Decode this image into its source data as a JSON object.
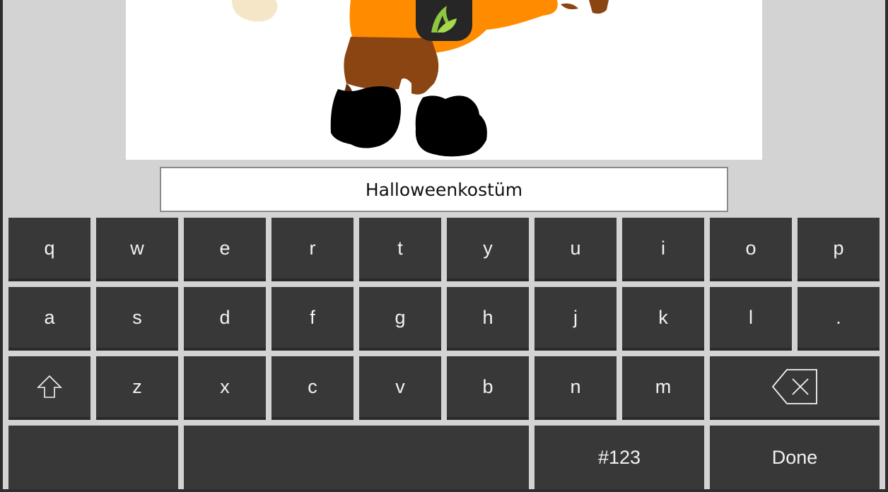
{
  "text_field": {
    "value": "Halloweenkostüm"
  },
  "image_panel": {
    "content": "pumpkin-costume-drawing"
  },
  "logo": {
    "icon": "app-logo-icon",
    "accent": "#8dc63f"
  },
  "keyboard": {
    "row1": [
      "q",
      "w",
      "e",
      "r",
      "t",
      "y",
      "u",
      "i",
      "o",
      "p"
    ],
    "row2": [
      "a",
      "s",
      "d",
      "f",
      "g",
      "h",
      "j",
      "k",
      "l",
      "."
    ],
    "row3": [
      "z",
      "x",
      "c",
      "v",
      "b",
      "n",
      "m"
    ],
    "shift_icon": "shift-icon",
    "backspace_icon": "backspace-icon",
    "symbols_label": "#123",
    "done_label": "Done"
  },
  "colors": {
    "key_bg": "#383838",
    "key_text": "#f2f2f2",
    "background": "#d3d3d3",
    "orange": "#ff8c00",
    "brown": "#8b4513"
  }
}
